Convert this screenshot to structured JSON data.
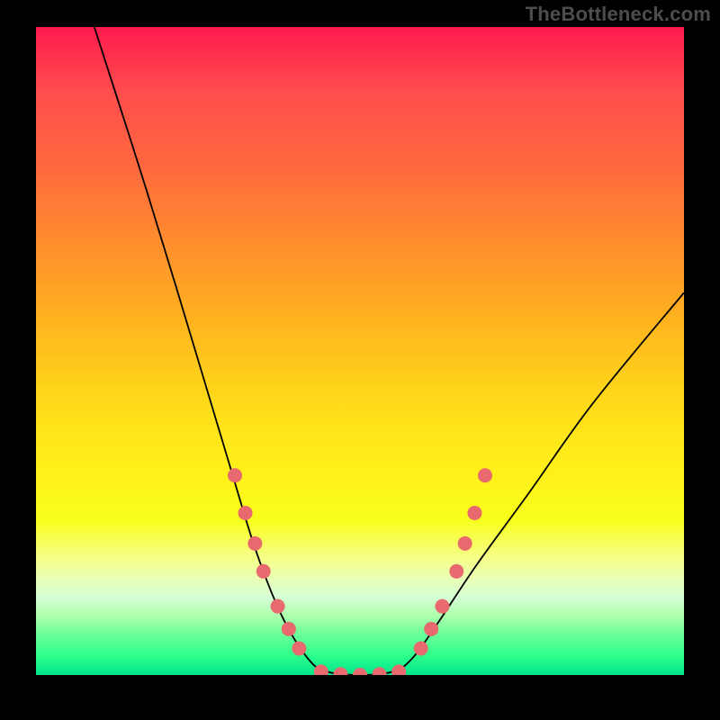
{
  "watermark": "TheBottleneck.com",
  "chart_data": {
    "type": "line",
    "title": "",
    "xlabel": "",
    "ylabel": "",
    "xlim": [
      0,
      100
    ],
    "ylim": [
      0,
      100
    ],
    "grid": false,
    "legend": false,
    "series": [
      {
        "name": "bottleneck-curve",
        "kind": "curve",
        "points": [
          {
            "x": 9,
            "y": 100
          },
          {
            "x": 17,
            "y": 75
          },
          {
            "x": 24,
            "y": 52
          },
          {
            "x": 30,
            "y": 32
          },
          {
            "x": 34,
            "y": 19
          },
          {
            "x": 38,
            "y": 9
          },
          {
            "x": 42,
            "y": 2.5
          },
          {
            "x": 45,
            "y": 0.5
          },
          {
            "x": 50,
            "y": 0
          },
          {
            "x": 55,
            "y": 0.5
          },
          {
            "x": 58,
            "y": 2.5
          },
          {
            "x": 62,
            "y": 8
          },
          {
            "x": 68,
            "y": 17
          },
          {
            "x": 76,
            "y": 28
          },
          {
            "x": 86,
            "y": 42
          },
          {
            "x": 100,
            "y": 59
          }
        ]
      },
      {
        "name": "markers-left",
        "kind": "markers",
        "points": [
          {
            "x": 30.7,
            "y": 30.8
          },
          {
            "x": 32.3,
            "y": 25.0
          },
          {
            "x": 33.8,
            "y": 20.3
          },
          {
            "x": 35.1,
            "y": 16.0
          },
          {
            "x": 37.3,
            "y": 10.6
          },
          {
            "x": 39.0,
            "y": 7.1
          },
          {
            "x": 40.6,
            "y": 4.1
          }
        ]
      },
      {
        "name": "markers-right",
        "kind": "markers",
        "points": [
          {
            "x": 59.4,
            "y": 4.1
          },
          {
            "x": 61.0,
            "y": 7.1
          },
          {
            "x": 62.7,
            "y": 10.6
          },
          {
            "x": 64.9,
            "y": 16.0
          },
          {
            "x": 66.2,
            "y": 20.3
          },
          {
            "x": 67.7,
            "y": 25.0
          },
          {
            "x": 69.3,
            "y": 30.8
          }
        ]
      },
      {
        "name": "markers-bottom",
        "kind": "markers",
        "points": [
          {
            "x": 44.0,
            "y": 0.5
          },
          {
            "x": 47.0,
            "y": 0.1
          },
          {
            "x": 50.0,
            "y": 0.0
          },
          {
            "x": 53.0,
            "y": 0.1
          },
          {
            "x": 56.0,
            "y": 0.5
          }
        ]
      }
    ],
    "marker_radius_px": 8,
    "colors": {
      "curve": "#000000",
      "marker": "#e86a6f",
      "gradient_top": "#ff1a4d",
      "gradient_bottom": "#00e68c",
      "frame": "#000000"
    }
  }
}
